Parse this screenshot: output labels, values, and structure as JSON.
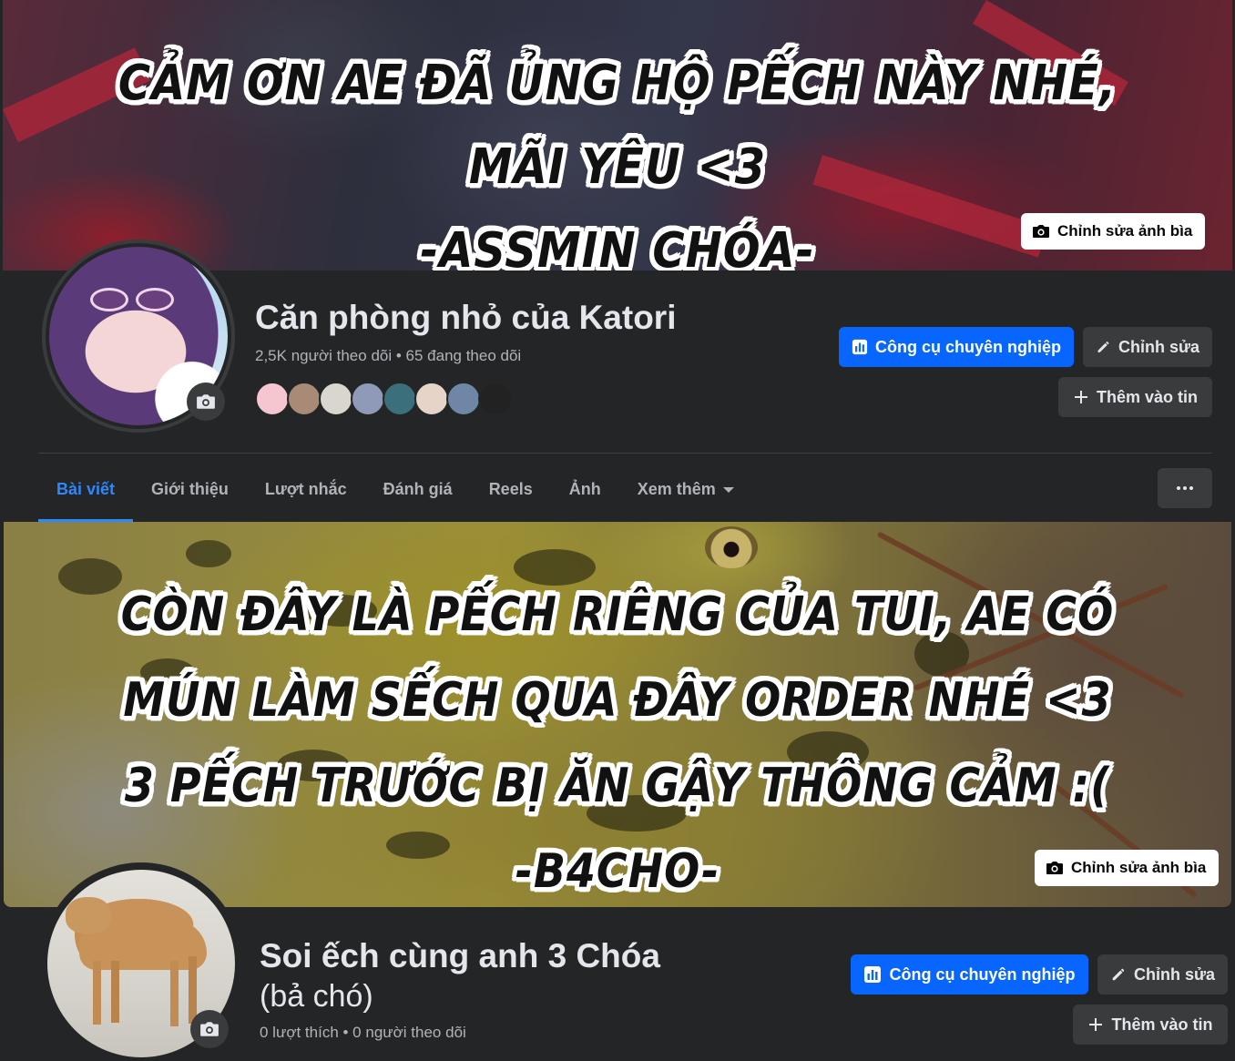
{
  "page1": {
    "cover_text": [
      "CẢM ƠN AE ĐÃ ỦNG HỘ PẾCH NÀY NHÉ,",
      "MÃI YÊU <3",
      "-ASSMIN CHÓA-"
    ],
    "edit_cover_label": "Chỉnh sửa ảnh bìa",
    "name": "Căn phòng nhỏ của Katori",
    "stats": "2,5K người theo dõi • 65 đang theo dõi",
    "followers": [
      "#f5c6cf",
      "#a98a76",
      "#d9d6cf",
      "#8f9ab8",
      "#3b6f7c",
      "#e7d4c9",
      "#6f86a6",
      "#222222"
    ],
    "buttons": {
      "pro_tools": "Công cụ chuyên nghiệp",
      "edit": "Chỉnh sửa",
      "add_story": "Thêm vào tin"
    },
    "tabs": [
      "Bài viết",
      "Giới thiệu",
      "Lượt nhắc",
      "Đánh giá",
      "Reels",
      "Ảnh",
      "Xem thêm"
    ],
    "active_tab": "Bài viết"
  },
  "page2": {
    "cover_text": [
      "CÒN ĐÂY LÀ PẾCH RIÊNG CỦA TUI, AE CÓ",
      "MÚN LÀM SẾCH QUA ĐÂY ORDER NHÉ <3",
      "3 PẾCH TRƯỚC BỊ ĂN GẬY THÔNG CẢM :(",
      "-B4CHO-"
    ],
    "edit_cover_label": "Chỉnh sửa ảnh bìa",
    "name": "Soi ếch cùng anh 3 Chóa",
    "category": "(bả chó)",
    "stats": "0 lượt thích • 0 người theo dõi",
    "buttons": {
      "pro_tools": "Công cụ chuyên nghiệp",
      "edit": "Chỉnh sửa",
      "add_story": "Thêm vào tin"
    }
  },
  "colors": {
    "background": "#242526",
    "accent_blue": "#0866ff",
    "active_tab": "#2d88ff",
    "secondary_button": "#3a3b3c",
    "muted_text": "#b0b3b8"
  },
  "icons": {
    "camera": "camera-icon",
    "insights": "bar-chart-icon",
    "pencil": "pencil-icon",
    "plus": "plus-icon",
    "dropdown": "caret-down-icon",
    "more": "more-dots-icon"
  }
}
